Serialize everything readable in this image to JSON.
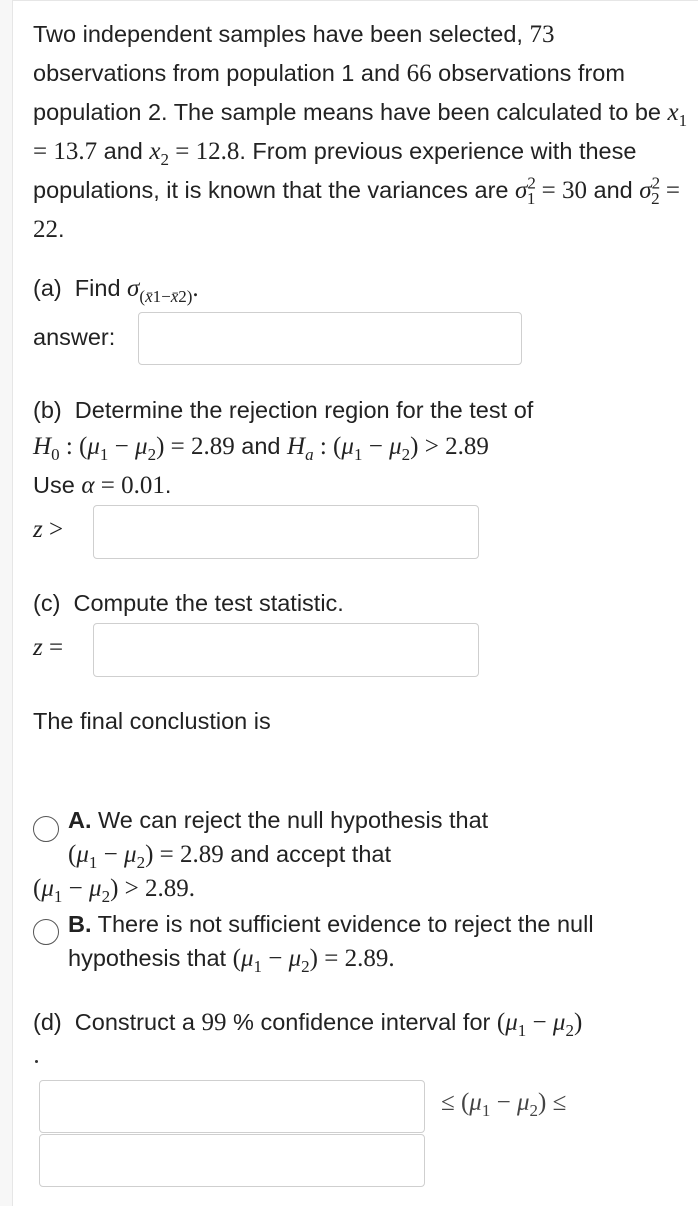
{
  "intro": {
    "t1": "Two independent samples have been selected, ",
    "n1": "73",
    "t2": " observations from population 1 and ",
    "n2": "66",
    "t3": " observations from population 2. The sample means have been calculated to be ",
    "xbar1_value": "13.7",
    "t4": " and ",
    "xbar2_value": "12.8",
    "t5": ". From previous experience with these populations, it is known that the variances are ",
    "var1": "30",
    "t6": " and ",
    "var2": "22",
    "t7": "."
  },
  "part_a": {
    "label": "(a)",
    "text": "Find",
    "answer_label": "answer:",
    "answer_value": ""
  },
  "part_b": {
    "label": "(b)",
    "text": "Determine the rejection region for the test of",
    "h0_value": "2.89",
    "and": " and ",
    "ha_value": "2.89",
    "use": "Use",
    "alpha": "0.01",
    "z_value": ""
  },
  "part_c": {
    "label": "(c)",
    "text": "Compute the test statistic.",
    "z_value": ""
  },
  "conclusion": {
    "text": "The final conclustion is",
    "option_a_letter": "A.",
    "option_a_text1": "We can reject the null hypothesis that",
    "option_a_val1": "2.89",
    "option_a_text2": " and accept that",
    "option_a_val2": "2.89",
    "option_b_letter": "B.",
    "option_b_text1": "There is not sufficient evidence to reject the null",
    "option_b_text2": "hypothesis that ",
    "option_b_val": "2.89"
  },
  "part_d": {
    "label": "(d)",
    "text1": "Construct a ",
    "percent": "99",
    "text2": " % confidence interval for ",
    "lower_value": "",
    "upper_value": ""
  }
}
